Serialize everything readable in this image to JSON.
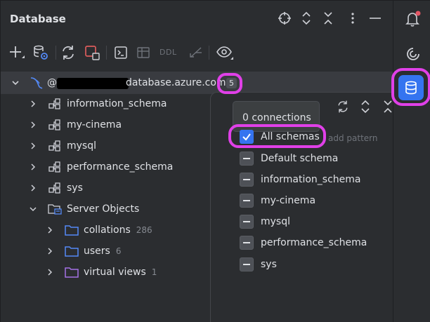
{
  "panel": {
    "title": "Database"
  },
  "toolbar": {
    "ddl_label": "DDL"
  },
  "connection": {
    "prefix": "@",
    "host_suffix": "database.azure.com",
    "schema_count": "5"
  },
  "tree": [
    {
      "label": "information_schema",
      "count": ""
    },
    {
      "label": "my-cinema",
      "count": ""
    },
    {
      "label": "mysql",
      "count": ""
    },
    {
      "label": "performance_schema",
      "count": ""
    },
    {
      "label": "sys",
      "count": ""
    },
    {
      "label": "Server Objects",
      "count": ""
    },
    {
      "label": "collations",
      "count": "286"
    },
    {
      "label": "users",
      "count": "6"
    },
    {
      "label": "virtual views",
      "count": "1"
    }
  ],
  "popup": {
    "tooltip": "0 connections",
    "pattern_placeholder": "add pattern",
    "schemas": [
      {
        "label": "All schemas",
        "state": "checked"
      },
      {
        "label": "Default schema",
        "state": "partial"
      },
      {
        "label": "information_schema",
        "state": "partial"
      },
      {
        "label": "my-cinema",
        "state": "partial"
      },
      {
        "label": "mysql",
        "state": "partial"
      },
      {
        "label": "performance_schema",
        "state": "partial"
      },
      {
        "label": "sys",
        "state": "partial"
      }
    ]
  },
  "colors": {
    "accent": "#3574f0",
    "highlight": "#e040e8",
    "notification": "#e55765",
    "background": "#2b2d30"
  },
  "icons": {
    "strip": [
      "bell-icon",
      "ai-assistant-icon",
      "database-icon"
    ]
  }
}
